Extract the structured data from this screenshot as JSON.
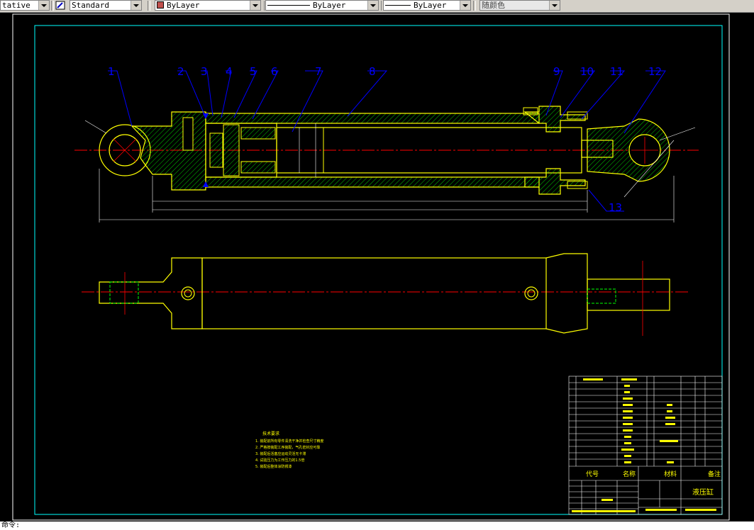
{
  "toolbar": {
    "dim_style": "tative",
    "text_style": "Standard",
    "layer": "ByLayer",
    "linetype": "ByLayer",
    "lineweight": "ByLayer",
    "plot_color": "随颜色"
  },
  "drawing": {
    "balloons": [
      "1",
      "2",
      "3",
      "4",
      "5",
      "6",
      "7",
      "8",
      "9",
      "10",
      "11",
      "12",
      "13"
    ],
    "tech_req_title": "技术要求",
    "tech_req": [
      "1. 装配前所有零件清洗干净并检查尺寸精度",
      "2. 严格按装配工序装配，气孔密封应可靠",
      "3. 装配后活塞应运动灵活无卡滞",
      "4. 试验压力为工作压力的1.5倍",
      "5. 装配后整体涂防锈漆"
    ],
    "title_block": {
      "name": "液压缸",
      "col_code": "代号",
      "col_name": "名称",
      "col_material": "材料",
      "col_note": "备注"
    }
  },
  "colors": {
    "background": "#000000",
    "frame": "#00ffff",
    "outline": "#ffff00",
    "centerline": "#ff0000",
    "leader": "#0000ff",
    "hatch": "#00ff00",
    "dimension": "#ffffff"
  },
  "cmdline": {
    "text": "命令:"
  }
}
